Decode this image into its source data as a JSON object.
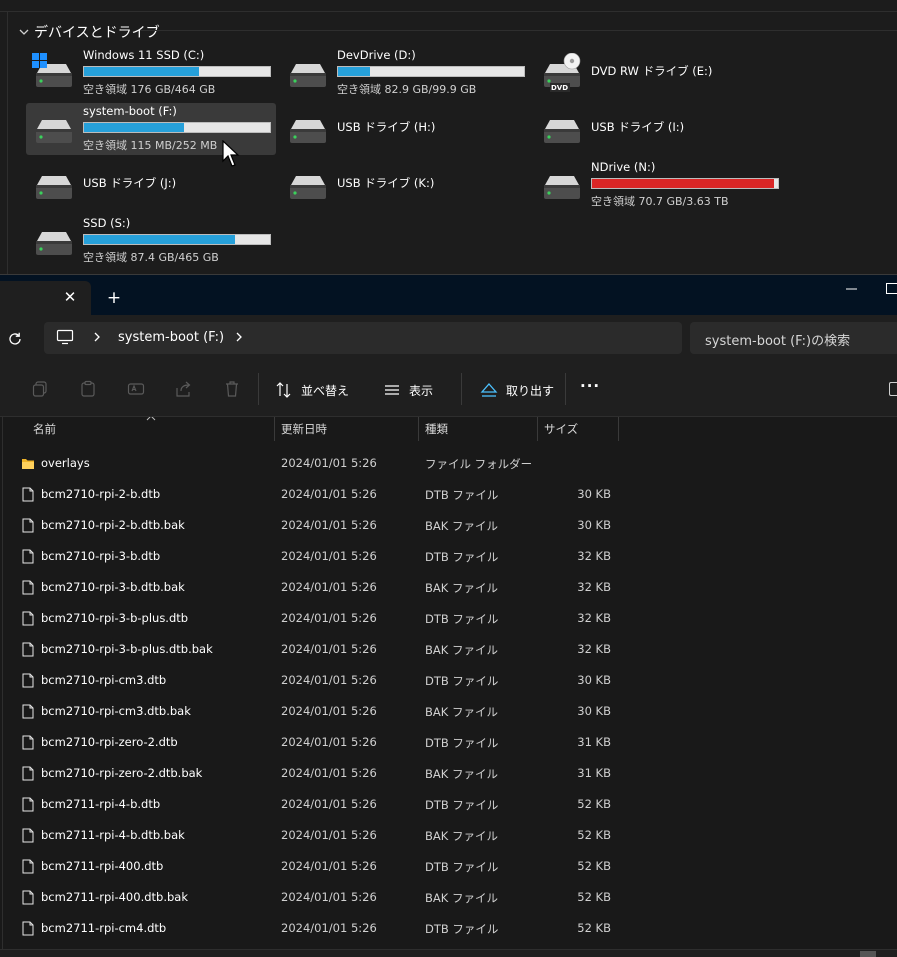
{
  "section": {
    "title": "デバイスとドライブ"
  },
  "drives": [
    {
      "name": "Windows 11 SSD (C:)",
      "free": "空き領域 176 GB/464 GB",
      "fill": 0.62,
      "bar": true,
      "bar_color": "#26a0da",
      "icon": "windows-drive-icon"
    },
    {
      "name": "DevDrive (D:)",
      "free": "空き領域 82.9 GB/99.9 GB",
      "fill": 0.17,
      "bar": true,
      "bar_color": "#26a0da",
      "icon": "drive-icon"
    },
    {
      "name": "DVD RW ドライブ (E:)",
      "free": "",
      "bar": false,
      "icon": "dvd-drive-icon",
      "icon_label": "DVD"
    },
    {
      "name": "system-boot (F:)",
      "free": "空き領域 115 MB/252 MB",
      "fill": 0.54,
      "bar": true,
      "bar_color": "#26a0da",
      "icon": "drive-icon",
      "selected": true
    },
    {
      "name": "USB ドライブ (H:)",
      "free": "",
      "bar": false,
      "icon": "drive-icon"
    },
    {
      "name": "USB ドライブ (I:)",
      "free": "",
      "bar": false,
      "icon": "drive-icon"
    },
    {
      "name": "USB ドライブ (J:)",
      "free": "",
      "bar": false,
      "icon": "drive-icon"
    },
    {
      "name": "USB ドライブ (K:)",
      "free": "",
      "bar": false,
      "icon": "drive-icon"
    },
    {
      "name": "NDrive (N:)",
      "free": "空き領域 70.7 GB/3.63 TB",
      "fill": 0.98,
      "bar": true,
      "bar_color": "#da2626",
      "icon": "drive-icon"
    },
    {
      "name": "SSD (S:)",
      "free": "空き領域 87.4 GB/465 GB",
      "fill": 0.81,
      "bar": true,
      "bar_color": "#26a0da",
      "icon": "drive-icon"
    }
  ],
  "tabbar": {
    "close_glyph": "✕",
    "new_tab_glyph": "+"
  },
  "address": {
    "location": "system-boot (F:)",
    "search_placeholder": "system-boot (F:)の検索"
  },
  "toolbar": {
    "sort_label": "並べ替え",
    "view_label": "表示",
    "eject_label": "取り出す",
    "more_glyph": "···"
  },
  "columns": {
    "name": "名前",
    "modified": "更新日時",
    "type": "種類",
    "size": "サイズ"
  },
  "files": [
    {
      "name": "overlays",
      "date": "2024/01/01 5:26",
      "type": "ファイル フォルダー",
      "size": "",
      "folder": true
    },
    {
      "name": "bcm2710-rpi-2-b.dtb",
      "date": "2024/01/01 5:26",
      "type": "DTB ファイル",
      "size": "30 KB"
    },
    {
      "name": "bcm2710-rpi-2-b.dtb.bak",
      "date": "2024/01/01 5:26",
      "type": "BAK ファイル",
      "size": "30 KB"
    },
    {
      "name": "bcm2710-rpi-3-b.dtb",
      "date": "2024/01/01 5:26",
      "type": "DTB ファイル",
      "size": "32 KB"
    },
    {
      "name": "bcm2710-rpi-3-b.dtb.bak",
      "date": "2024/01/01 5:26",
      "type": "BAK ファイル",
      "size": "32 KB"
    },
    {
      "name": "bcm2710-rpi-3-b-plus.dtb",
      "date": "2024/01/01 5:26",
      "type": "DTB ファイル",
      "size": "32 KB"
    },
    {
      "name": "bcm2710-rpi-3-b-plus.dtb.bak",
      "date": "2024/01/01 5:26",
      "type": "BAK ファイル",
      "size": "32 KB"
    },
    {
      "name": "bcm2710-rpi-cm3.dtb",
      "date": "2024/01/01 5:26",
      "type": "DTB ファイル",
      "size": "30 KB"
    },
    {
      "name": "bcm2710-rpi-cm3.dtb.bak",
      "date": "2024/01/01 5:26",
      "type": "BAK ファイル",
      "size": "30 KB"
    },
    {
      "name": "bcm2710-rpi-zero-2.dtb",
      "date": "2024/01/01 5:26",
      "type": "DTB ファイル",
      "size": "31 KB"
    },
    {
      "name": "bcm2710-rpi-zero-2.dtb.bak",
      "date": "2024/01/01 5:26",
      "type": "BAK ファイル",
      "size": "31 KB"
    },
    {
      "name": "bcm2711-rpi-4-b.dtb",
      "date": "2024/01/01 5:26",
      "type": "DTB ファイル",
      "size": "52 KB"
    },
    {
      "name": "bcm2711-rpi-4-b.dtb.bak",
      "date": "2024/01/01 5:26",
      "type": "BAK ファイル",
      "size": "52 KB"
    },
    {
      "name": "bcm2711-rpi-400.dtb",
      "date": "2024/01/01 5:26",
      "type": "DTB ファイル",
      "size": "52 KB"
    },
    {
      "name": "bcm2711-rpi-400.dtb.bak",
      "date": "2024/01/01 5:26",
      "type": "BAK ファイル",
      "size": "52 KB"
    },
    {
      "name": "bcm2711-rpi-cm4.dtb",
      "date": "2024/01/01 5:26",
      "type": "DTB ファイル",
      "size": "52 KB"
    }
  ]
}
